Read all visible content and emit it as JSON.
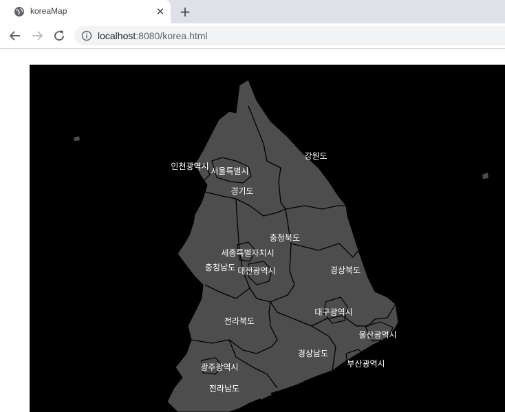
{
  "browser": {
    "tab_title": "koreaMap",
    "tab_close_glyph": "✕",
    "new_tab_glyph": "+",
    "url_host": "localhost",
    "url_rest": ":8080/korea.html",
    "icons": {
      "favicon": "globe-icon",
      "back": "arrow-left-icon",
      "forward": "arrow-right-icon",
      "reload": "reload-icon",
      "site_info": "info-icon"
    }
  },
  "map": {
    "background_color": "#000000",
    "land_color": "#4d4d4d",
    "border_color": "#000000",
    "label_color": "#ffffff",
    "regions": [
      {
        "key": "gangwon",
        "label": "강원도"
      },
      {
        "key": "incheon",
        "label": "인천광역시"
      },
      {
        "key": "seoul",
        "label": "서울특별시"
      },
      {
        "key": "gyeonggi",
        "label": "경기도"
      },
      {
        "key": "chungbuk",
        "label": "충청북도"
      },
      {
        "key": "sejong",
        "label": "세종특별자치시"
      },
      {
        "key": "chungnam",
        "label": "충청남도"
      },
      {
        "key": "daejeon",
        "label": "대전광역시"
      },
      {
        "key": "gyeongbuk",
        "label": "경상북도"
      },
      {
        "key": "daegu",
        "label": "대구광역시"
      },
      {
        "key": "ulsan",
        "label": "울산광역시"
      },
      {
        "key": "jeonbuk",
        "label": "전라북도"
      },
      {
        "key": "gyeongnam",
        "label": "경상남도"
      },
      {
        "key": "busan",
        "label": "부산광역시"
      },
      {
        "key": "gwangju",
        "label": "광주광역시"
      },
      {
        "key": "jeonnam",
        "label": "전라남도"
      }
    ]
  }
}
